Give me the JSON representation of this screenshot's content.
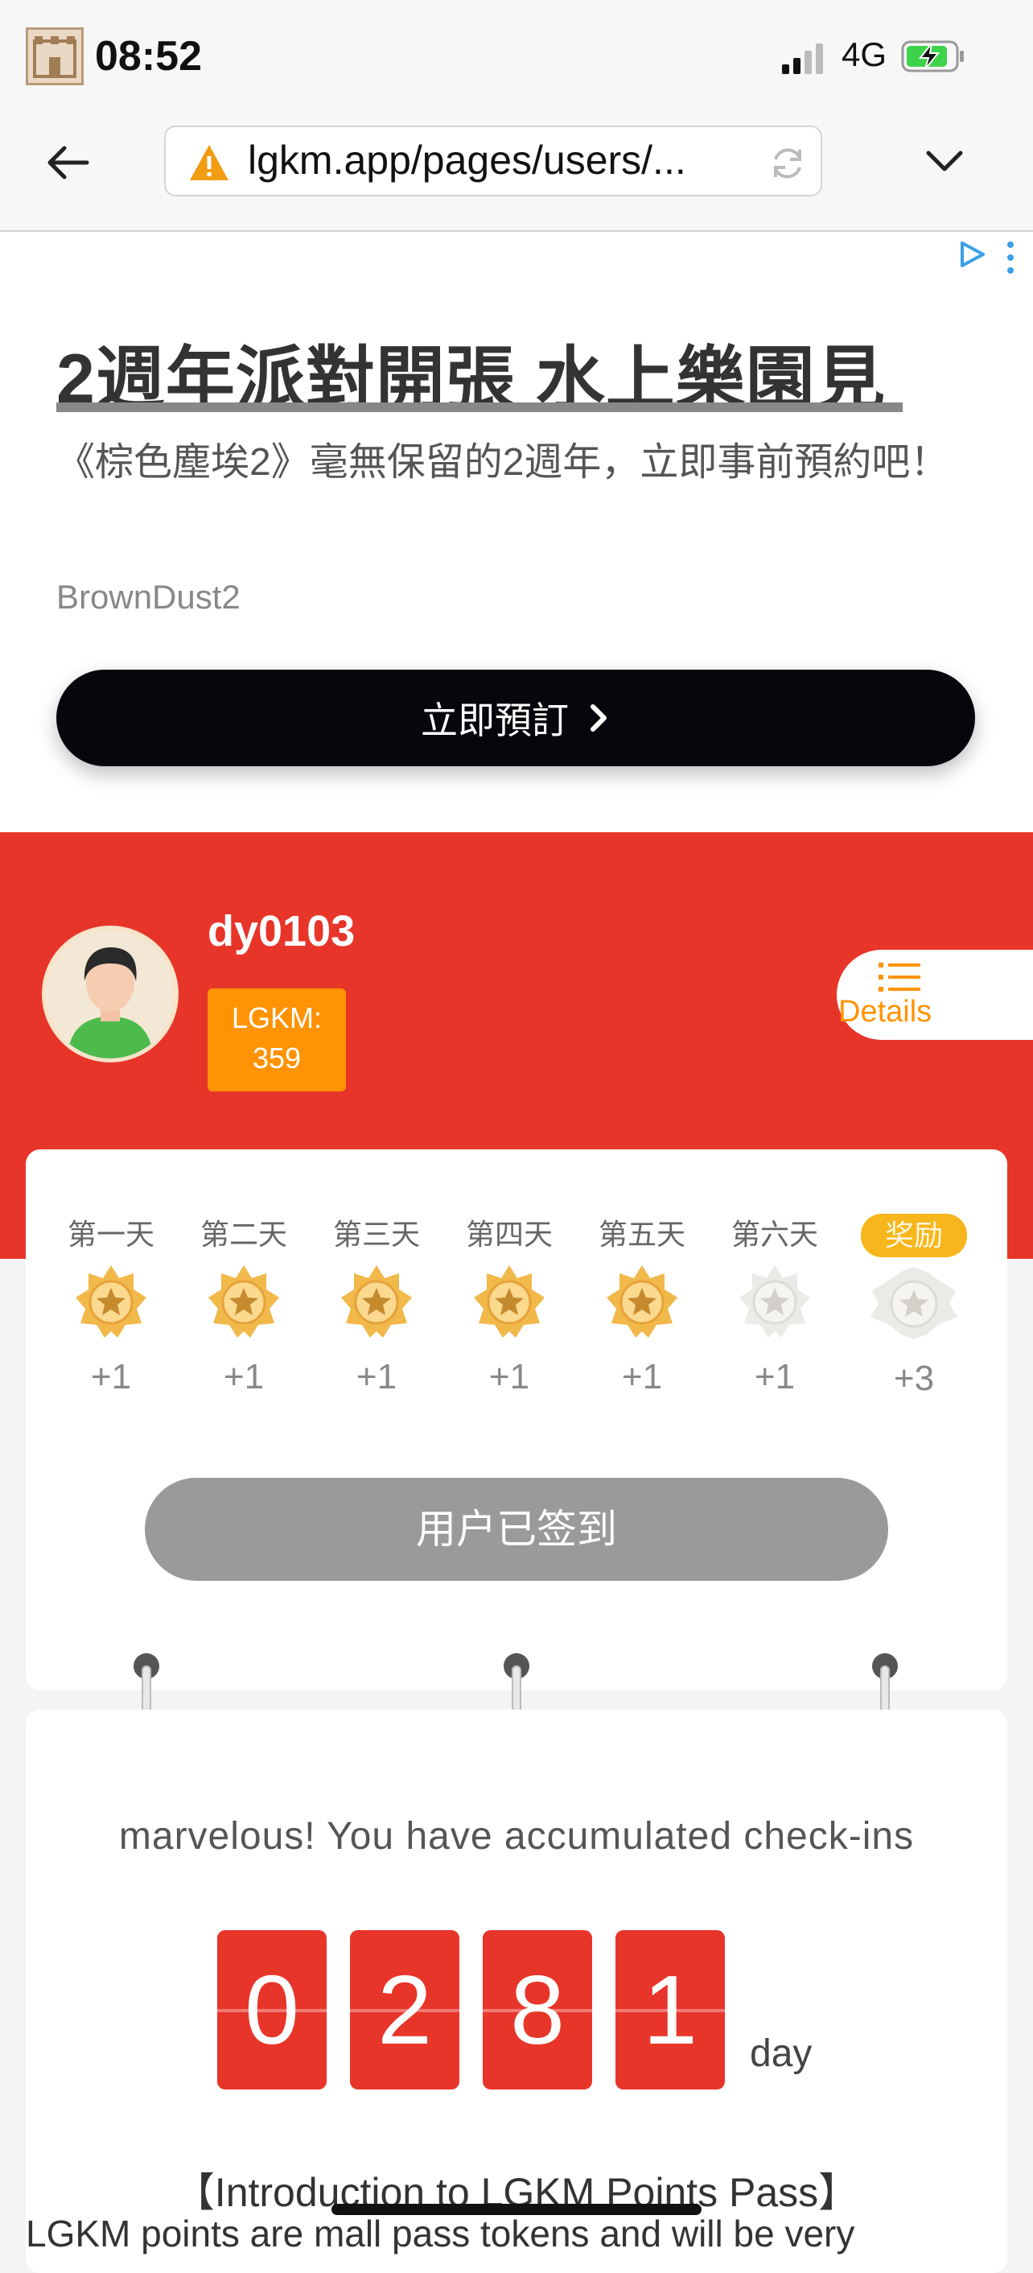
{
  "status_bar": {
    "time": "08:52",
    "network": "4G"
  },
  "browser": {
    "url": "lgkm.app/pages/users/..."
  },
  "ad": {
    "headline": "2週年派對開張 水上樂園見",
    "description": "《棕色塵埃2》毫無保留的2週年，立即事前預約吧！",
    "brand": "BrownDust2",
    "cta_label": "立即預訂"
  },
  "profile": {
    "username": "dy0103",
    "points_label": "LGKM:",
    "points_value": "359",
    "details_label": "Details"
  },
  "checkin": {
    "days": [
      {
        "label": "第一天",
        "points": "+1",
        "done": true
      },
      {
        "label": "第二天",
        "points": "+1",
        "done": true
      },
      {
        "label": "第三天",
        "points": "+1",
        "done": true
      },
      {
        "label": "第四天",
        "points": "+1",
        "done": true
      },
      {
        "label": "第五天",
        "points": "+1",
        "done": true
      },
      {
        "label": "第六天",
        "points": "+1",
        "done": false
      },
      {
        "label": "奖励",
        "points": "+3",
        "done": false
      }
    ],
    "signed_label": "用户已签到"
  },
  "accumulated": {
    "message": "marvelous! You have accumulated check-ins",
    "digits": [
      "0",
      "2",
      "8",
      "1"
    ],
    "unit": "day",
    "intro_title": "【Introduction to LGKM Points Pass】",
    "intro_text": "LGKM points are mall pass tokens and will be very"
  },
  "colors": {
    "brand_red": "#e8352a",
    "points_orange": "#ff9304",
    "reward_yellow": "#f6b61c",
    "signed_gray": "#9a9a9a"
  }
}
